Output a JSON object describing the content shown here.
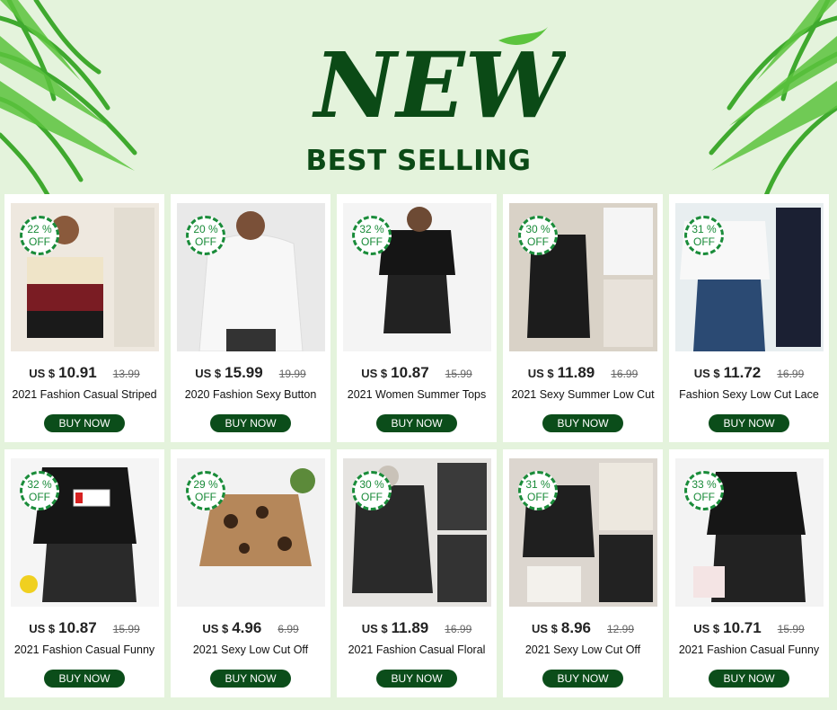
{
  "banner": {
    "headline": "NEW",
    "subtitle": "BEST SELLING",
    "colors": {
      "background": "#e4f3dc",
      "brand_green": "#0b4d1a",
      "badge_green": "#1a8c3a"
    }
  },
  "products": [
    {
      "discount": "22 %",
      "off": "OFF",
      "currency": "US $",
      "price": "10.91",
      "old_price": "13.99",
      "name": "2021 Fashion Casual  Striped",
      "button": "BUY NOW"
    },
    {
      "discount": "20 %",
      "off": "OFF",
      "currency": "US $",
      "price": "15.99",
      "old_price": "19.99",
      "name": "2020 Fashion Sexy  Button",
      "button": "BUY NOW"
    },
    {
      "discount": "32 %",
      "off": "OFF",
      "currency": "US $",
      "price": "10.87",
      "old_price": "15.99",
      "name": "2021  Women Summer Tops",
      "button": "BUY NOW"
    },
    {
      "discount": "30 %",
      "off": "OFF",
      "currency": "US $",
      "price": "11.89",
      "old_price": "16.99",
      "name": "2021 Sexy  Summer Low Cut",
      "button": "BUY NOW"
    },
    {
      "discount": "31 %",
      "off": "OFF",
      "currency": "US $",
      "price": "11.72",
      "old_price": "16.99",
      "name": "Fashion Sexy Low Cut Lace",
      "button": "BUY NOW"
    },
    {
      "discount": "32 %",
      "off": "OFF",
      "currency": "US $",
      "price": "10.87",
      "old_price": "15.99",
      "name": "2021 Fashion Casual  Funny",
      "button": "BUY NOW"
    },
    {
      "discount": "29 %",
      "off": "OFF",
      "currency": "US $",
      "price": "4.96",
      "old_price": "6.99",
      "name": "2021 Sexy Low Cut Off",
      "button": "BUY NOW"
    },
    {
      "discount": "30 %",
      "off": "OFF",
      "currency": "US $",
      "price": "11.89",
      "old_price": "16.99",
      "name": "2021 Fashion Casual  Floral",
      "button": "BUY NOW"
    },
    {
      "discount": "31 %",
      "off": "OFF",
      "currency": "US $",
      "price": "8.96",
      "old_price": "12.99",
      "name": "2021 Sexy Low Cut Off",
      "button": "BUY NOW"
    },
    {
      "discount": "33 %",
      "off": "OFF",
      "currency": "US $",
      "price": "10.71",
      "old_price": "15.99",
      "name": "2021 Fashion Casual  Funny",
      "button": "BUY NOW"
    }
  ]
}
